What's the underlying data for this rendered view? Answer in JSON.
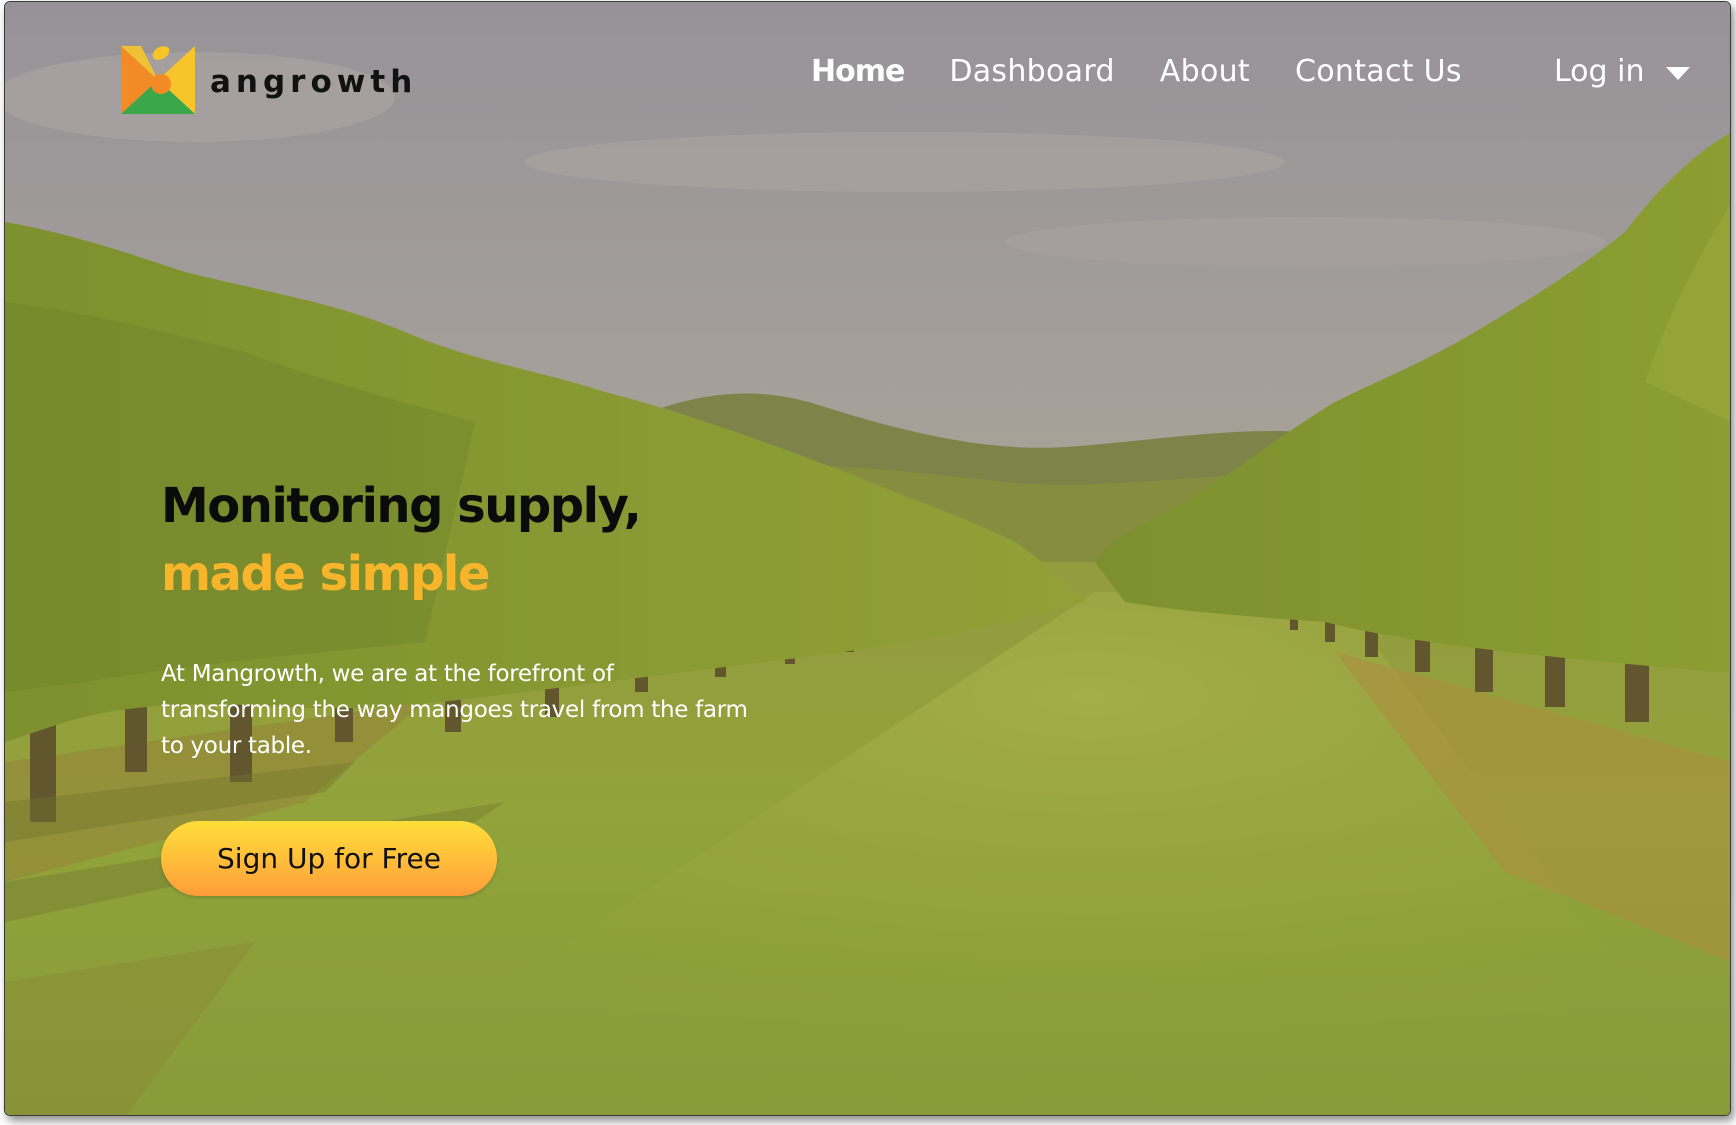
{
  "brand": {
    "name": "angrowth",
    "colors": {
      "mark_orange": "#f28a26",
      "mark_yellow": "#f7c52a",
      "mark_green": "#3aa84a",
      "accent": "#f7b52c"
    }
  },
  "nav": {
    "items": [
      {
        "label": "Home",
        "active": true
      },
      {
        "label": "Dashboard",
        "active": false
      },
      {
        "label": "About",
        "active": false
      },
      {
        "label": "Contact Us",
        "active": false
      }
    ],
    "login": {
      "label": "Log in",
      "icon": "chevron-down-icon"
    }
  },
  "hero": {
    "headline_line1": "Monitoring supply,",
    "headline_line2": "made simple",
    "description": "At Mangrowth, we are at the forefront of transforming the way mangoes travel from the farm to your table.",
    "cta_label": "Sign Up for Free"
  },
  "background": {
    "subject": "mango orchard rows with grassy path and hills",
    "overlay_color": "#d9a64a"
  }
}
